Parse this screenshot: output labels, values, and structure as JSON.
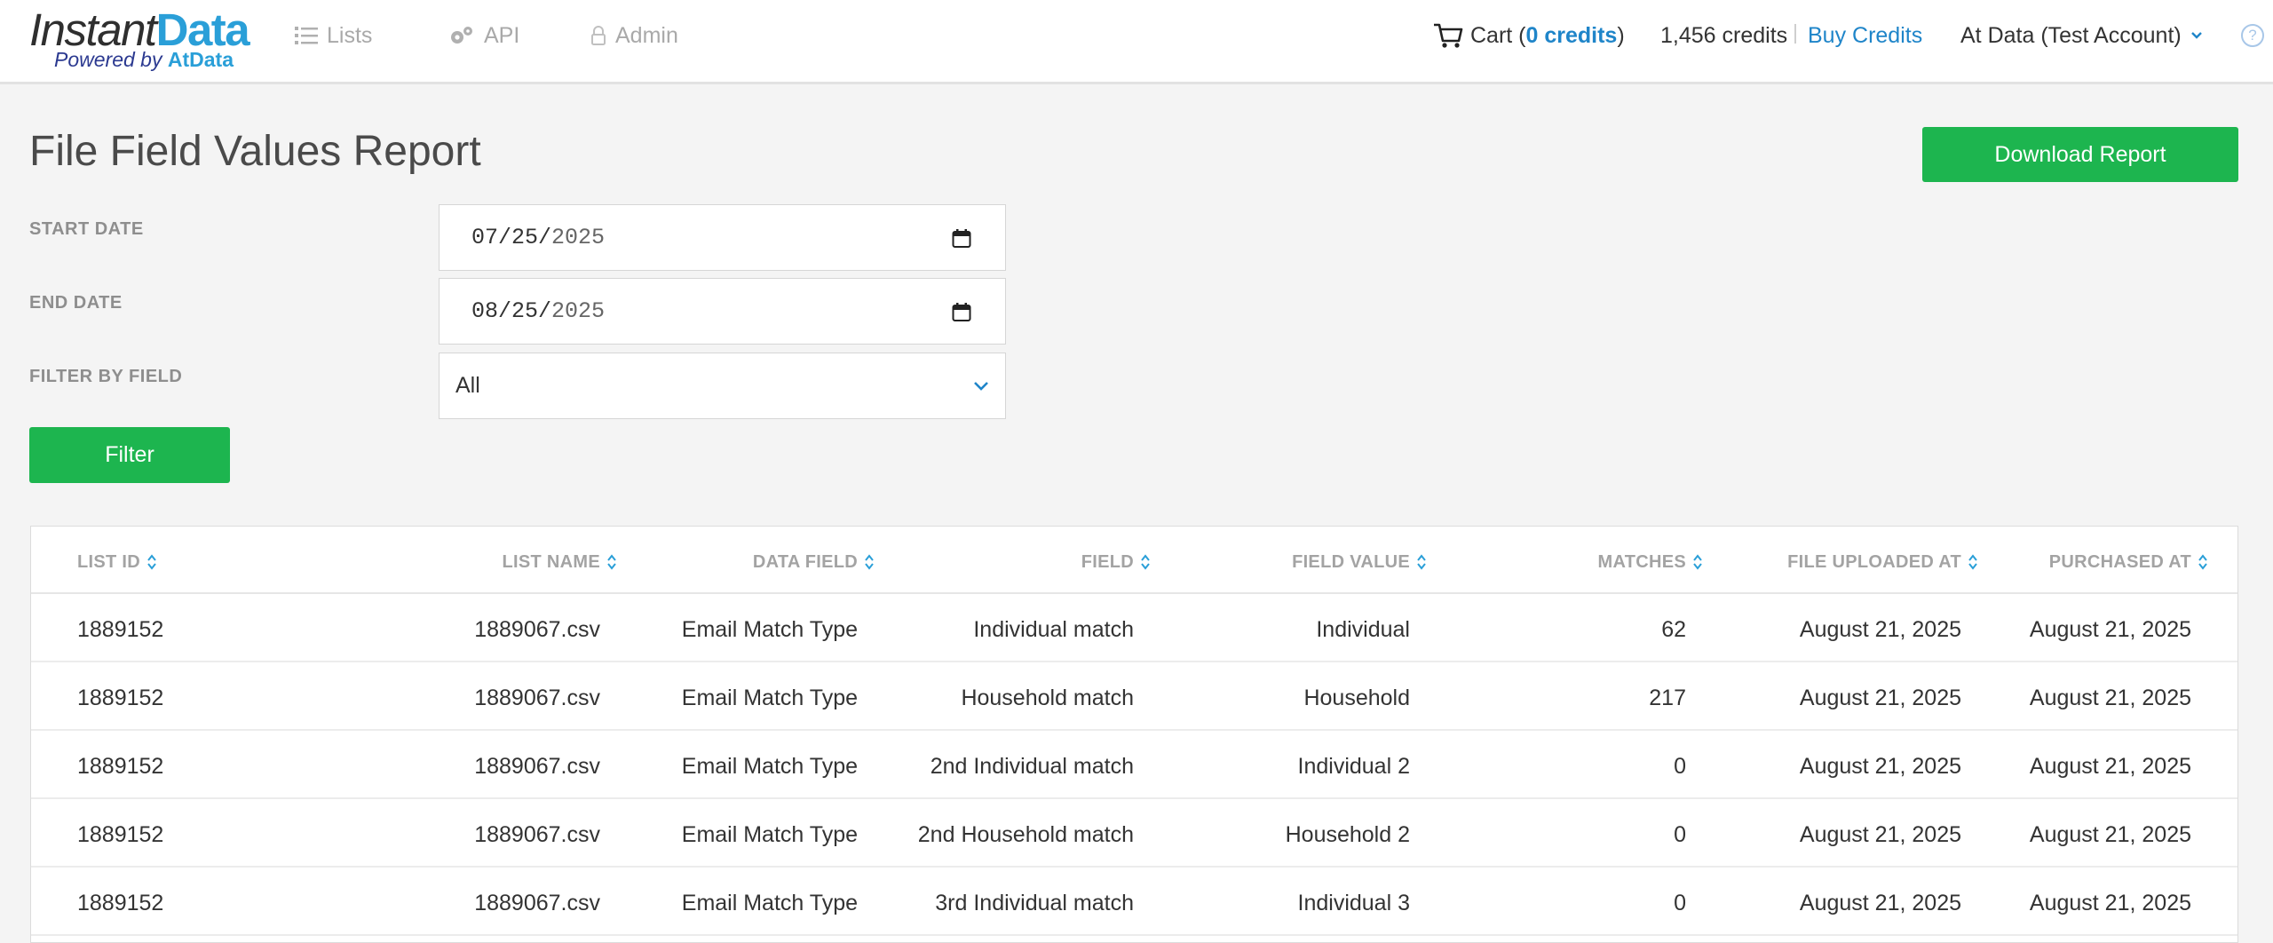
{
  "brand": {
    "name_part1": "Instant",
    "name_part2": "Data",
    "tagline_prefix": "Powered by ",
    "tagline_brand": "AtData"
  },
  "nav": {
    "lists_label": "Lists",
    "api_label": "API",
    "admin_label": "Admin"
  },
  "header": {
    "cart_label": "Cart (",
    "cart_credits": "0 credits",
    "cart_close": ")",
    "credit_balance": "1,456 credits",
    "buy_credits_label": "Buy Credits",
    "account_name": "At Data (Test Account)",
    "help_glyph": "?"
  },
  "page": {
    "title": "File Field Values Report",
    "download_label": "Download Report",
    "filter_label": "Filter"
  },
  "form": {
    "start_date_label": "START DATE",
    "start_date_value_md": "07/25/",
    "start_date_value_y": "2025",
    "end_date_label": "END DATE",
    "end_date_value_md": "08/25/",
    "end_date_value_y": "2025",
    "filter_field_label": "FILTER BY FIELD",
    "filter_field_value": "All"
  },
  "table": {
    "columns": [
      "LIST ID",
      "LIST NAME",
      "DATA FIELD",
      "FIELD",
      "FIELD VALUE",
      "MATCHES",
      "FILE UPLOADED AT",
      "PURCHASED AT"
    ],
    "rows": [
      [
        "1889152",
        "1889067.csv",
        "Email Match Type",
        "Individual match",
        "Individual",
        "62",
        "August 21, 2025",
        "August 21, 2025"
      ],
      [
        "1889152",
        "1889067.csv",
        "Email Match Type",
        "Household match",
        "Household",
        "217",
        "August 21, 2025",
        "August 21, 2025"
      ],
      [
        "1889152",
        "1889067.csv",
        "Email Match Type",
        "2nd Individual match",
        "Individual 2",
        "0",
        "August 21, 2025",
        "August 21, 2025"
      ],
      [
        "1889152",
        "1889067.csv",
        "Email Match Type",
        "2nd Household match",
        "Household 2",
        "0",
        "August 21, 2025",
        "August 21, 2025"
      ],
      [
        "1889152",
        "1889067.csv",
        "Email Match Type",
        "3rd Individual match",
        "Individual 3",
        "0",
        "August 21, 2025",
        "August 21, 2025"
      ]
    ]
  },
  "icons": {
    "lists": "list-icon",
    "api": "gears-icon",
    "admin": "lock-icon",
    "cart": "cart-icon",
    "account_menu": "chevron-down-icon",
    "help": "question-icon",
    "calendar": "calendar-icon",
    "select": "chevron-down-icon",
    "sort": "sort-icon"
  },
  "colors": {
    "accent_blue": "#1f85c9",
    "brand_blue": "#2a9fd8",
    "button_green": "#1db54f",
    "muted_label": "#8e8e8e"
  }
}
